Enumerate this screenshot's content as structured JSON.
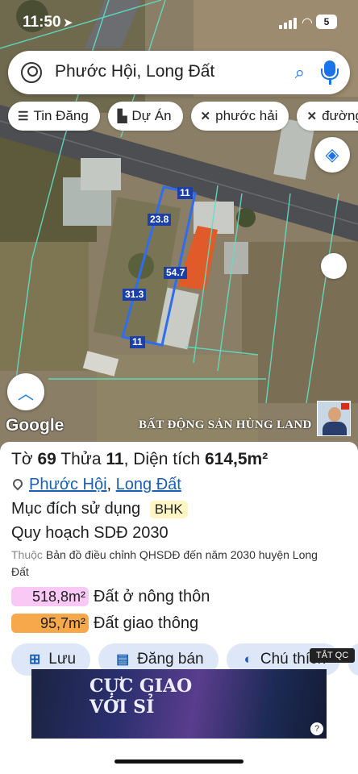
{
  "status_bar": {
    "time": "11:50",
    "battery": "5"
  },
  "search": {
    "query": "Phước Hội, Long Đất"
  },
  "chips": [
    {
      "icon": "list-icon",
      "label": "Tin Đăng"
    },
    {
      "icon": "building-icon",
      "label": "Dự Án"
    },
    {
      "icon": "tag-icon",
      "label": "phước hải"
    },
    {
      "icon": "tag-icon",
      "label": "đường"
    }
  ],
  "map": {
    "logo": "Google",
    "watermark": "BẤT ĐỘNG SẢN HÙNG LAND",
    "plot_labels": {
      "top": "11",
      "left_upper": "23.8",
      "right": "54.7",
      "left_lower": "31.3",
      "bottom": "11"
    }
  },
  "parcel": {
    "to_label": "Tờ",
    "to_value": "69",
    "thua_label": "Thửa",
    "thua_value": "11",
    "area_label": "Diện tích",
    "area_value": "614,5m²",
    "ward": "Phước Hội",
    "separator": ",",
    "district": "Long Đất",
    "purpose_label": "Mục đích sử dụng",
    "purpose_code": "BHK",
    "plan_label": "Quy hoạch SDĐ 2030",
    "belongs_prefix": "Thuộc",
    "belongs_text": "Bản đồ điều chỉnh QHSDĐ đến năm 2030 huyện Long Đất",
    "areas": [
      {
        "value": "518,8m²",
        "label": "Đất ở nông thôn",
        "color": "#f9c8f4"
      },
      {
        "value": "95,7m²",
        "label": "Đất giao thông",
        "color": "#f7a84a"
      }
    ]
  },
  "actions": {
    "save": "Lưu",
    "post": "Đăng bán",
    "legend": "Chú thích"
  },
  "ad": {
    "close_label": "TẮT QC",
    "text_line1": "CỰC GIAO",
    "text_line2": "VỚI SỈ",
    "info": "?"
  }
}
